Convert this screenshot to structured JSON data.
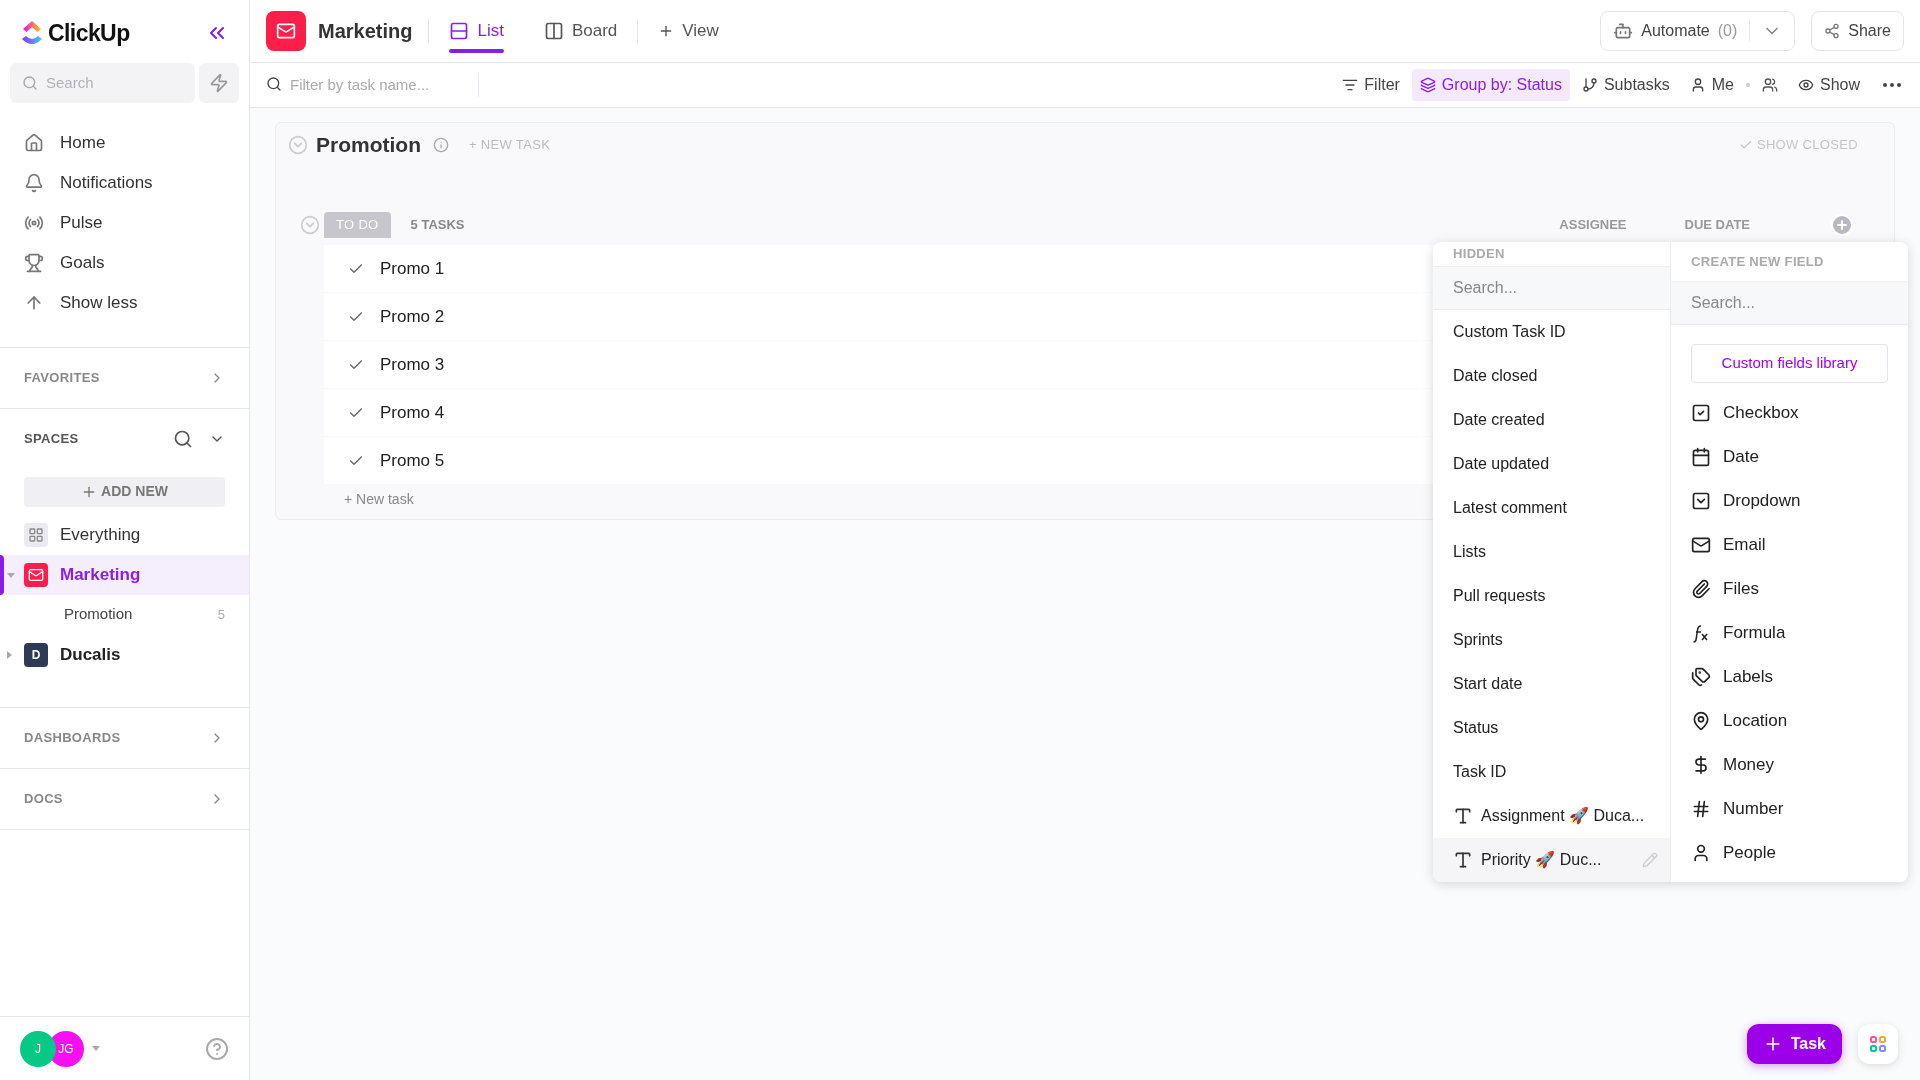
{
  "sidebar": {
    "logo": "ClickUp",
    "search": {
      "placeholder": "Search"
    },
    "nav": [
      {
        "label": "Home",
        "kind": "home"
      },
      {
        "label": "Notifications",
        "kind": "bell"
      },
      {
        "label": "Pulse",
        "kind": "pulse"
      },
      {
        "label": "Goals",
        "kind": "trophy"
      },
      {
        "label": "Show less",
        "kind": "up"
      }
    ],
    "favorites": "FAVORITES",
    "spaces": {
      "title": "SPACES",
      "add_new": "ADD NEW",
      "items": [
        {
          "kind": "everything",
          "label": "Everything",
          "selected": false
        },
        {
          "kind": "space",
          "label": "Marketing",
          "color": "#fd1f4a",
          "selected": true,
          "expanded": true,
          "children": [
            {
              "label": "Promotion",
              "count": "5"
            }
          ]
        },
        {
          "kind": "space",
          "label": "Ducalis",
          "letter": "D",
          "color": "#2f3a55",
          "selected": false,
          "expanded": false
        }
      ]
    },
    "sections": [
      "DASHBOARDS",
      "DOCS"
    ],
    "avatars": [
      {
        "initials": "J",
        "color": "#06c985"
      },
      {
        "initials": "JG",
        "color": "#f70ff0"
      }
    ]
  },
  "header": {
    "space": "Marketing",
    "tabs": [
      {
        "label": "List",
        "kind": "list",
        "selected": true
      },
      {
        "label": "Board",
        "kind": "board",
        "selected": false
      }
    ],
    "add_view": "View",
    "automate": "Automate",
    "automate_count": "(0)",
    "share": "Share"
  },
  "toolbar": {
    "filter_placeholder": "Filter by task name...",
    "buttons": [
      {
        "label": "Filter",
        "kind": "filter",
        "active": false
      },
      {
        "label": "Group by: Status",
        "kind": "layers",
        "active": true
      },
      {
        "label": "Subtasks",
        "kind": "subtasks",
        "active": false
      },
      {
        "label": "Me",
        "kind": "me",
        "active": false
      },
      {
        "label": "Show",
        "kind": "eye",
        "active": false
      }
    ]
  },
  "list": {
    "title": "Promotion",
    "new_task": "+ NEW TASK",
    "show_closed": "SHOW CLOSED",
    "group": {
      "status": "TO DO",
      "count": "5 TASKS",
      "columns": [
        "ASSIGNEE",
        "DUE DATE"
      ],
      "tasks": [
        "Promo 1",
        "Promo 2",
        "Promo 3",
        "Promo 4",
        "Promo 5"
      ],
      "new_task": "+ New task"
    }
  },
  "fields_menu": {
    "hidden": {
      "title": "HIDDEN",
      "placeholder": "Search...",
      "items": [
        {
          "label": "Custom Task ID",
          "kind": "builtin",
          "hovered": false
        },
        {
          "label": "Date closed",
          "kind": "builtin",
          "hovered": false
        },
        {
          "label": "Date created",
          "kind": "builtin",
          "hovered": false
        },
        {
          "label": "Date updated",
          "kind": "builtin",
          "hovered": false
        },
        {
          "label": "Latest comment",
          "kind": "builtin",
          "hovered": false
        },
        {
          "label": "Lists",
          "kind": "builtin",
          "hovered": false
        },
        {
          "label": "Pull requests",
          "kind": "builtin",
          "hovered": false
        },
        {
          "label": "Sprints",
          "kind": "builtin",
          "hovered": false
        },
        {
          "label": "Start date",
          "kind": "builtin",
          "hovered": false
        },
        {
          "label": "Status",
          "kind": "builtin",
          "hovered": false
        },
        {
          "label": "Task ID",
          "kind": "builtin",
          "hovered": false
        },
        {
          "label": "Assignment 🚀 Duca...",
          "kind": "custom",
          "hovered": false
        },
        {
          "label": "Priority 🚀 Duc...",
          "kind": "custom",
          "hovered": true
        }
      ]
    },
    "create": {
      "title": "CREATE NEW FIELD",
      "placeholder": "Search...",
      "library": "Custom fields library",
      "types": [
        {
          "label": "Checkbox",
          "kind": "checkbox"
        },
        {
          "label": "Date",
          "kind": "calendar"
        },
        {
          "label": "Dropdown",
          "kind": "dropdown"
        },
        {
          "label": "Email",
          "kind": "mail"
        },
        {
          "label": "Files",
          "kind": "clip"
        },
        {
          "label": "Formula",
          "kind": "formula"
        },
        {
          "label": "Labels",
          "kind": "tags"
        },
        {
          "label": "Location",
          "kind": "pin"
        },
        {
          "label": "Money",
          "kind": "dollar"
        },
        {
          "label": "Number",
          "kind": "hash"
        },
        {
          "label": "People",
          "kind": "person"
        }
      ]
    }
  },
  "fab": {
    "label": "Task"
  }
}
